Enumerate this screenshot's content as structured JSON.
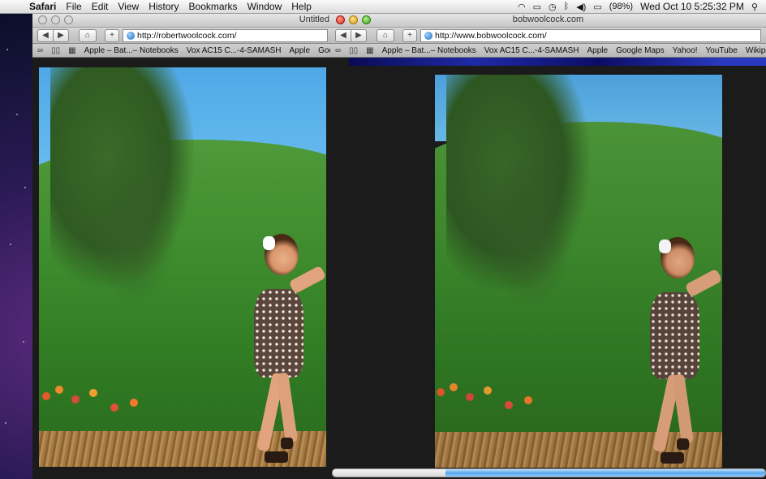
{
  "menubar": {
    "items": [
      "Safari",
      "File",
      "Edit",
      "View",
      "History",
      "Bookmarks",
      "Window",
      "Help"
    ],
    "battery": "(98%)",
    "datetime": "Wed Oct 10  5:25:32 PM"
  },
  "window_left": {
    "title": "Untitled",
    "url": "http://robertwoolcock.com/",
    "bookmarks": [
      "Apple – Bat...– Notebooks",
      "Vox AC15 C...-4-SAMASH",
      "Apple",
      "Goo"
    ]
  },
  "window_right": {
    "title": "bobwoolcock.com",
    "url": "http://www.bobwoolcock.com/",
    "bookmarks": [
      "Apple – Bat...– Notebooks",
      "Vox AC15 C...-4-SAMASH",
      "Apple",
      "Google Maps",
      "Yahoo!",
      "YouTube",
      "Wikiped"
    ],
    "load_progress": 0.26
  },
  "icons": {
    "apple": "",
    "back": "◀",
    "forward": "▶",
    "add": "+",
    "reader": "⌂",
    "reading_list": "⛭",
    "top_sites": "▦"
  },
  "colors": {
    "accent": "#1a6ac0",
    "close": "#d22a1a",
    "minimize": "#d99a10",
    "zoom": "#3aa020"
  }
}
